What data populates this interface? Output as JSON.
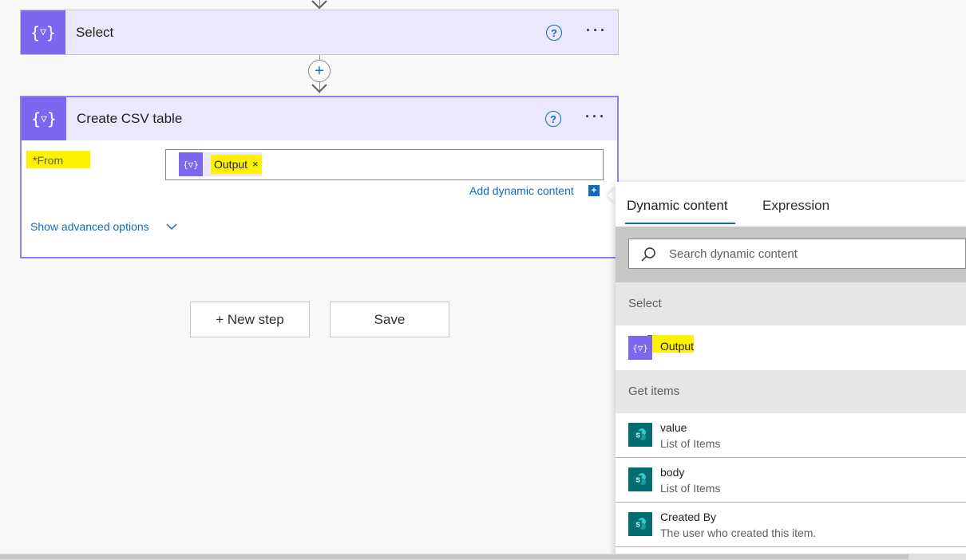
{
  "canvas": {
    "select_step": {
      "title": "Select",
      "icon": "data-operation-icon"
    },
    "csv_step": {
      "title": "Create CSV table",
      "icon": "data-operation-icon",
      "from_label": "From",
      "required_marker": "*",
      "token_label": "Output",
      "token_remove": "×",
      "add_dynamic_label": "Add dynamic content",
      "show_advanced_label": "Show advanced options"
    },
    "new_step_label": "+ New step",
    "save_label": "Save"
  },
  "dynamic_panel": {
    "tabs": [
      {
        "label": "Dynamic content",
        "active": true
      },
      {
        "label": "Expression",
        "active": false
      }
    ],
    "search_placeholder": "Search dynamic content",
    "sections": [
      {
        "header": "Select",
        "items": [
          {
            "name": "Output",
            "description": "",
            "icon": "data-operation-icon"
          }
        ]
      },
      {
        "header": "Get items",
        "items": [
          {
            "name": "value",
            "description": "List of Items",
            "icon": "sharepoint-icon"
          },
          {
            "name": "body",
            "description": "List of Items",
            "icon": "sharepoint-icon"
          },
          {
            "name": "Created By",
            "description": "The user who created this item.",
            "icon": "sharepoint-icon"
          }
        ]
      }
    ]
  },
  "colors": {
    "accent": "#0f6cbd",
    "step_icon": "#7b68ee",
    "step_header": "#ebe8fd",
    "highlight": "#fff200",
    "sharepoint": "#036c70"
  }
}
